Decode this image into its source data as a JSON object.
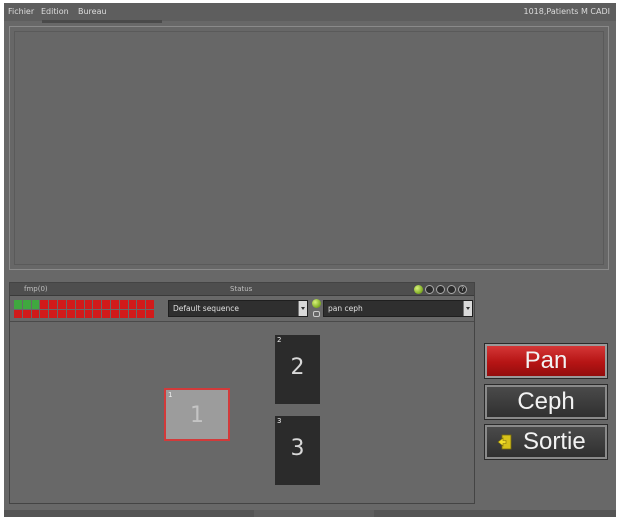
{
  "menu": {
    "items": [
      "Fichier",
      "Edition",
      "Bureau"
    ]
  },
  "header": {
    "patient": "1018,Patients M CADI"
  },
  "status_bar": {
    "fmp": "fmp(0)",
    "status": "Status",
    "help_icon_glyph": "?"
  },
  "progress": {
    "total": 32,
    "completed": 3
  },
  "sequence": {
    "selected": "Default sequence"
  },
  "program": {
    "selected": "pan ceph"
  },
  "tiles": [
    {
      "index": "1",
      "number": "1",
      "state": "selected"
    },
    {
      "index": "2",
      "number": "2",
      "state": "normal"
    },
    {
      "index": "3",
      "number": "3",
      "state": "normal"
    }
  ],
  "actions": {
    "pan": "Pan",
    "ceph": "Ceph",
    "exit": "Sortie"
  },
  "colors": {
    "accent_red": "#c01a1a",
    "led_green": "#9bc832",
    "progress_done": "#3fa83f",
    "progress_pending": "#d11a1a"
  },
  "icons": {
    "exit": "exit-door-icon",
    "led": "status-led-icon",
    "print": "print-icon",
    "settings": "settings-icon",
    "filter": "filter-icon",
    "help": "help-icon"
  }
}
